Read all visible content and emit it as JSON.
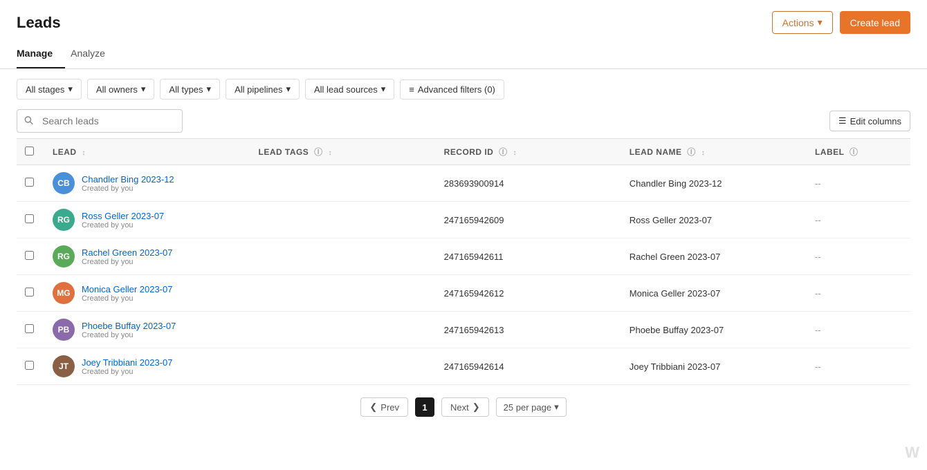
{
  "page": {
    "title": "Leads"
  },
  "header": {
    "actions_label": "Actions",
    "create_lead_label": "Create lead"
  },
  "tabs": [
    {
      "id": "manage",
      "label": "Manage",
      "active": true
    },
    {
      "id": "analyze",
      "label": "Analyze",
      "active": false
    }
  ],
  "filters": {
    "stages_label": "All stages",
    "owners_label": "All owners",
    "types_label": "All types",
    "pipelines_label": "All pipelines",
    "lead_sources_label": "All lead sources",
    "advanced_label": "Advanced filters (0)"
  },
  "toolbar": {
    "search_placeholder": "Search leads",
    "edit_columns_label": "Edit columns"
  },
  "table": {
    "columns": [
      {
        "id": "lead",
        "label": "LEAD",
        "sortable": true,
        "info": false
      },
      {
        "id": "lead_tags",
        "label": "LEAD TAGS",
        "sortable": true,
        "info": true
      },
      {
        "id": "record_id",
        "label": "RECORD ID",
        "sortable": true,
        "info": true
      },
      {
        "id": "lead_name",
        "label": "LEAD NAME",
        "sortable": true,
        "info": true
      },
      {
        "id": "label",
        "label": "LABEL",
        "sortable": false,
        "info": true
      }
    ],
    "rows": [
      {
        "id": 1,
        "name": "Chandler Bing 2023-12",
        "sub": "Created by you",
        "lead_tags": "",
        "record_id": "283693900914",
        "lead_name": "Chandler Bing 2023-12",
        "label": "--",
        "avatar_initials": "CB",
        "avatar_color": "av-blue"
      },
      {
        "id": 2,
        "name": "Ross Geller 2023-07",
        "sub": "Created by you",
        "lead_tags": "",
        "record_id": "247165942609",
        "lead_name": "Ross Geller 2023-07",
        "label": "--",
        "avatar_initials": "RG",
        "avatar_color": "av-teal"
      },
      {
        "id": 3,
        "name": "Rachel Green 2023-07",
        "sub": "Created by you",
        "lead_tags": "",
        "record_id": "247165942611",
        "lead_name": "Rachel Green 2023-07",
        "label": "--",
        "avatar_initials": "RG",
        "avatar_color": "av-green"
      },
      {
        "id": 4,
        "name": "Monica Geller 2023-07",
        "sub": "Created by you",
        "lead_tags": "",
        "record_id": "247165942612",
        "lead_name": "Monica Geller 2023-07",
        "label": "--",
        "avatar_initials": "MG",
        "avatar_color": "av-orange"
      },
      {
        "id": 5,
        "name": "Phoebe Buffay 2023-07",
        "sub": "Created by you",
        "lead_tags": "",
        "record_id": "247165942613",
        "lead_name": "Phoebe Buffay 2023-07",
        "label": "--",
        "avatar_initials": "PB",
        "avatar_color": "av-purple"
      },
      {
        "id": 6,
        "name": "Joey Tribbiani 2023-07",
        "sub": "Created by you",
        "lead_tags": "",
        "record_id": "247165942614",
        "lead_name": "Joey Tribbiani 2023-07",
        "label": "--",
        "avatar_initials": "JT",
        "avatar_color": "av-brown"
      }
    ]
  },
  "pagination": {
    "prev_label": "Prev",
    "next_label": "Next",
    "current_page": "1",
    "per_page_label": "25 per page"
  }
}
